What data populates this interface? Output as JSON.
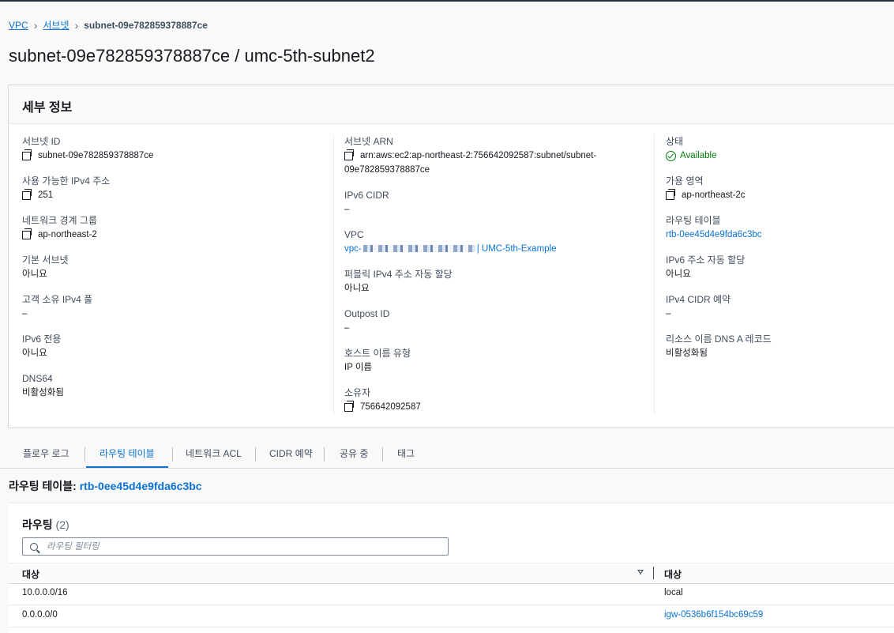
{
  "breadcrumb": {
    "items": [
      "VPC",
      "서브넷"
    ],
    "current": "subnet-09e782859378887ce"
  },
  "page_title": "subnet-09e782859378887ce / umc-5th-subnet2",
  "details": {
    "title": "세부 정보",
    "subnet_id": {
      "label": "서브넷 ID",
      "value": "subnet-09e782859378887ce"
    },
    "ipv4_available": {
      "label": "사용 가능한 IPv4 주소",
      "value": "251"
    },
    "network_border_group": {
      "label": "네트워크 경계 그룹",
      "value": "ap-northeast-2"
    },
    "default_subnet": {
      "label": "기본 서브넷",
      "value": "아니요"
    },
    "customer_owned_pool": {
      "label": "고객 소유 IPv4 풀",
      "value": "–"
    },
    "ipv6_only": {
      "label": "IPv6 전용",
      "value": "아니요"
    },
    "dns64": {
      "label": "DNS64",
      "value": "비활성화됨"
    },
    "subnet_arn": {
      "label": "서브넷 ARN",
      "line1": "arn:aws:ec2:ap-northeast-2:756642092587:subnet/subnet-",
      "line2": "09e782859378887ce"
    },
    "ipv6_cidr": {
      "label": "IPv6 CIDR",
      "value": "–"
    },
    "vpc": {
      "label": "VPC",
      "prefix": "vpc-",
      "suffix": "| UMC-5th-Example"
    },
    "auto_public_ipv4": {
      "label": "퍼블릭 IPv4 주소 자동 할당",
      "value": "아니요"
    },
    "outpost_id": {
      "label": "Outpost ID",
      "value": "–"
    },
    "hostname_type": {
      "label": "호스트 이름 유형",
      "value": "IP 이름"
    },
    "owner": {
      "label": "소유자",
      "value": "756642092587"
    },
    "state": {
      "label": "상태",
      "value": "Available"
    },
    "availability_zone": {
      "label": "가용 영역",
      "value": "ap-northeast-2c"
    },
    "route_table": {
      "label": "라우팅 테이블",
      "value": "rtb-0ee45d4e9fda6c3bc"
    },
    "ipv6_auto_assign": {
      "label": "IPv6 주소 자동 할당",
      "value": "아니요"
    },
    "ipv4_cidr_reservation": {
      "label": "IPv4 CIDR 예약",
      "value": "–"
    },
    "resource_name_dns_a": {
      "label": "리소스 이름 DNS A 레코드",
      "value": "비활성화됨"
    }
  },
  "tabs": [
    "플로우 로그",
    "라우팅 테이블",
    "네트워크 ACL",
    "CIDR 예약",
    "공유 중",
    "태그"
  ],
  "active_tab": "라우팅 테이블",
  "route_table_line": {
    "label": "라우팅 테이블: ",
    "value": "rtb-0ee45d4e9fda6c3bc"
  },
  "routes": {
    "title": "라우팅",
    "count": "(2)",
    "filter_placeholder": "라우팅 필터링",
    "columns": [
      "대상",
      "대상"
    ],
    "rows": [
      {
        "destination": "10.0.0.0/16",
        "target": "local"
      },
      {
        "destination": "0.0.0.0/0",
        "target": "igw-0536b6f154bc69c59"
      }
    ]
  },
  "colors": {
    "link": "#0972d3",
    "success": "#037f0c",
    "text": "#16191f"
  }
}
